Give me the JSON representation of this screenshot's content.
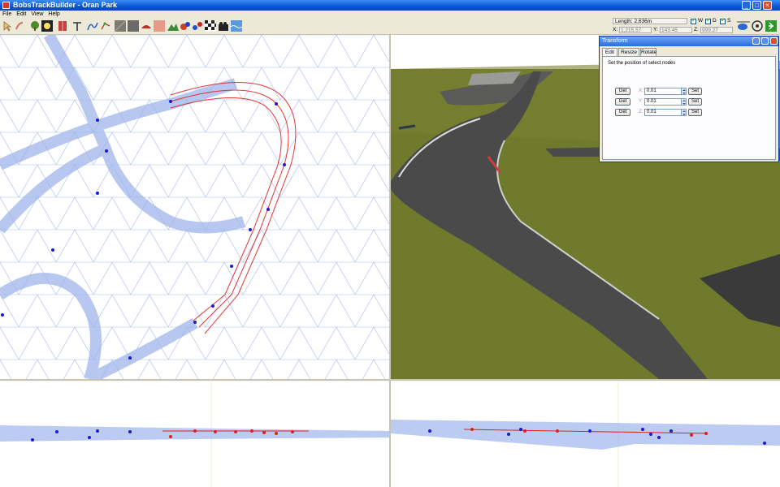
{
  "window": {
    "title": "BobsTrackBuilder - Oran Park"
  },
  "menu": [
    "File",
    "Edit",
    "View",
    "Help"
  ],
  "toolbar_icons": [
    "pointer-icon",
    "paint-icon",
    "tree-icon",
    "lamp-icon",
    "wall-icon",
    "text-icon",
    "road-icon",
    "spline-icon",
    "texture-icon",
    "grey-block-icon",
    "shoe-icon",
    "pink-block-icon",
    "terrain-icon",
    "paint-splash-icon",
    "molecule-icon",
    "checker-flag-icon",
    "camera-icon",
    "water-icon"
  ],
  "status": {
    "length": "Length: 2,636m",
    "checks": [
      {
        "label": "W"
      },
      {
        "label": "D"
      },
      {
        "label": "S"
      }
    ],
    "x_label": "X:",
    "x_value": "1,215.57",
    "y_label": "Y:",
    "y_value": "143.45",
    "z_label": "Z:",
    "z_value": "999.27"
  },
  "transform": {
    "title": "Transform",
    "tabs": [
      "Edit",
      "Resize",
      "Rotate"
    ],
    "active_tab": "Edit",
    "description": "Set the position of select nodes",
    "rows": [
      {
        "axis": "X:",
        "value": "0.01",
        "get": "Get",
        "set": "Set"
      },
      {
        "axis": "Y:",
        "value": "0.01",
        "get": "Get",
        "set": "Set"
      },
      {
        "axis": "Z:",
        "value": "0.01",
        "get": "Get",
        "set": "Set"
      }
    ]
  },
  "colors": {
    "wire": "#8fa9e8",
    "selected": "#e02020",
    "node": "#1a1ad0",
    "grass": "#6f7a2c",
    "asphalt": "#4a4a4a"
  }
}
